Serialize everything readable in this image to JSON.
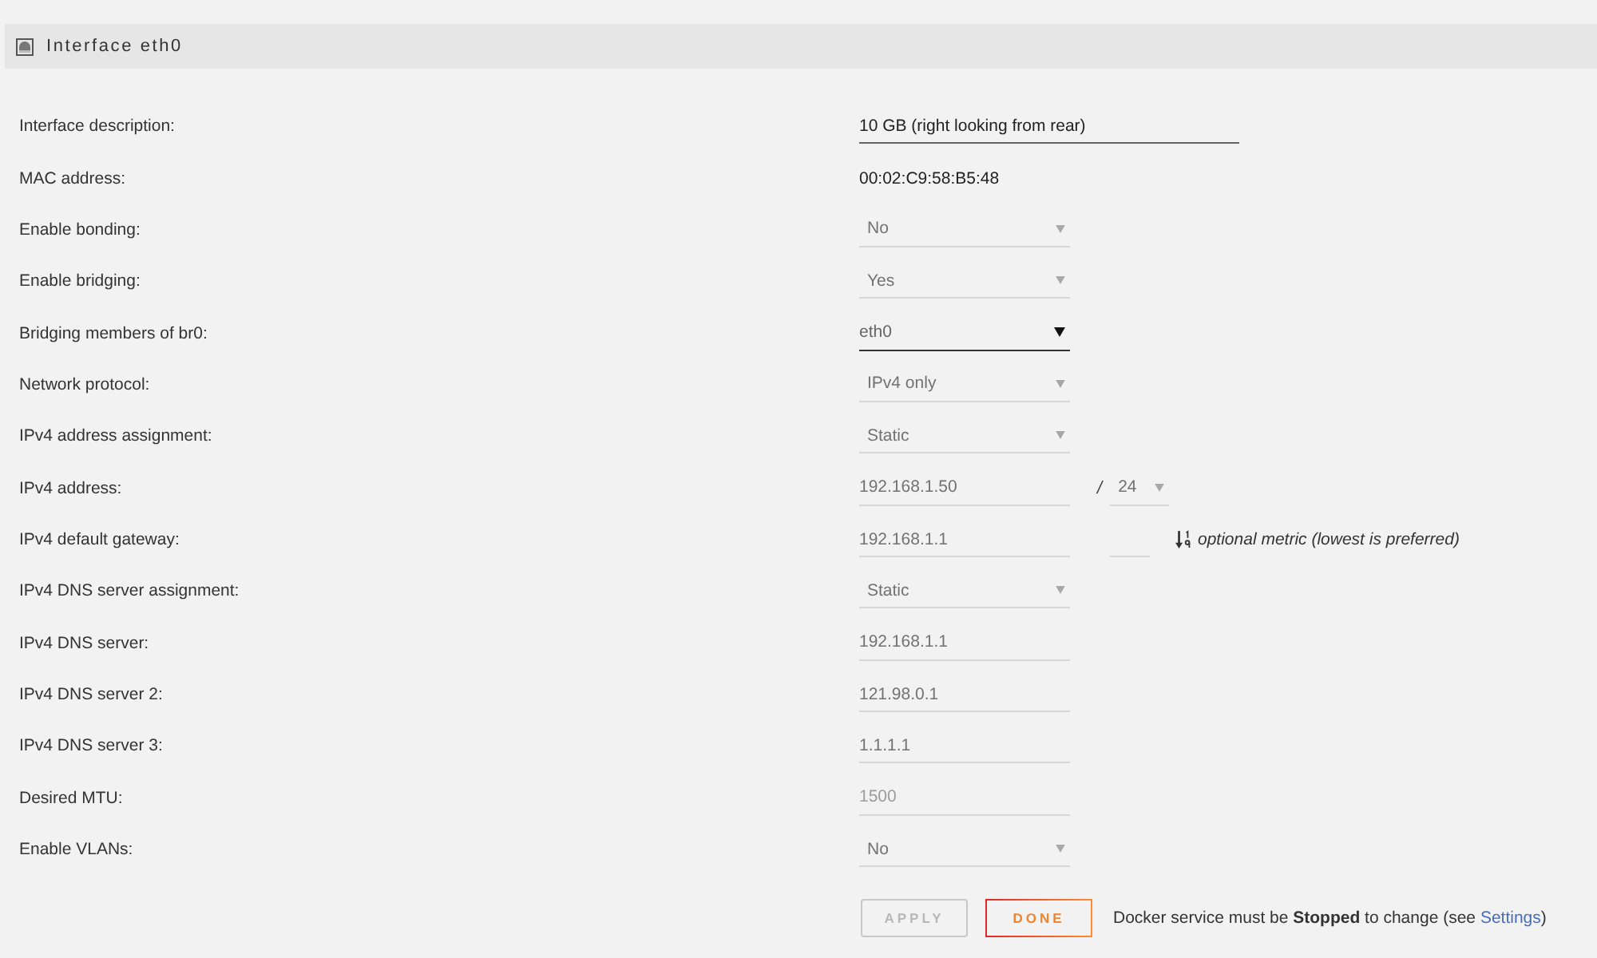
{
  "panel": {
    "title": "Interface eth0"
  },
  "fields": [
    {
      "label": "Interface description:",
      "kind": "text",
      "value": "10 GB (right looking from rear)",
      "disabled": false
    },
    {
      "label": "MAC address:",
      "kind": "static",
      "value": "00:02:C9:58:B5:48"
    },
    {
      "label": "Enable bonding:",
      "kind": "select",
      "value": "No",
      "disabled": true
    },
    {
      "label": "Enable bridging:",
      "kind": "select",
      "value": "Yes",
      "disabled": true
    },
    {
      "label": "Bridging members of br0:",
      "kind": "select",
      "value": "eth0",
      "disabled": false
    },
    {
      "label": "Network protocol:",
      "kind": "select",
      "value": "IPv4 only",
      "disabled": true
    },
    {
      "label": "IPv4 address assignment:",
      "kind": "select",
      "value": "Static",
      "disabled": true
    },
    {
      "label": "IPv4 address:",
      "kind": "address",
      "value": "192.168.1.50",
      "separator": "/",
      "netmask": "24",
      "disabled": true
    },
    {
      "label": "IPv4 default gateway:",
      "kind": "gateway",
      "value": "192.168.1.1",
      "hint": "optional metric (lowest is preferred)",
      "disabled": true
    },
    {
      "label": "IPv4 DNS server assignment:",
      "kind": "select",
      "value": "Static",
      "disabled": true
    },
    {
      "label": "IPv4 DNS server:",
      "kind": "text",
      "value": "192.168.1.1",
      "disabled": true
    },
    {
      "label": "IPv4 DNS server 2:",
      "kind": "text",
      "value": "121.98.0.1",
      "disabled": true
    },
    {
      "label": "IPv4 DNS server 3:",
      "kind": "text",
      "value": "1.1.1.1",
      "disabled": true
    },
    {
      "label": "Desired MTU:",
      "kind": "text",
      "placeholder": "1500",
      "disabled": true
    },
    {
      "label": "Enable VLANs:",
      "kind": "select",
      "value": "No",
      "disabled": true
    }
  ],
  "buttons": [
    {
      "label": "APPLY",
      "kind": "apply",
      "disabled": true
    },
    {
      "label": "DONE",
      "kind": "done",
      "disabled": false
    }
  ],
  "note": {
    "text": "Docker service must be **Stopped** to change (see ",
    "link": "Settings",
    "suffix": ")"
  }
}
